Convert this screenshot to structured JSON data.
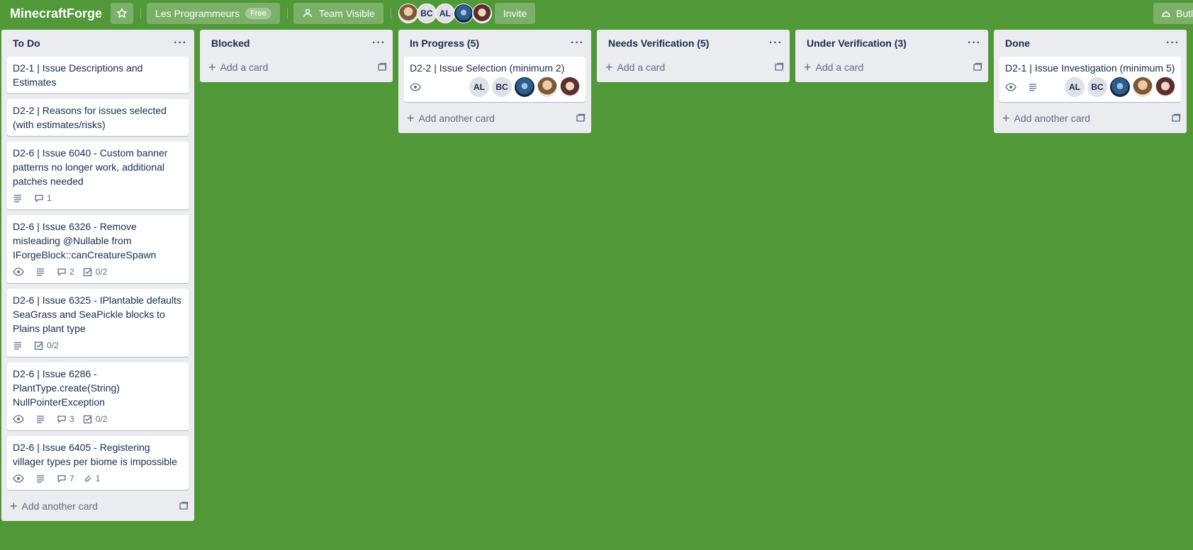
{
  "header": {
    "board_title": "MinecraftForge",
    "team_name": "Les Programmeurs",
    "plan_badge": "Free",
    "visibility": "Team Visible",
    "member_initials": [
      "BC",
      "AL"
    ],
    "invite": "Invite",
    "right_button": "Butler"
  },
  "lists": [
    {
      "title": "To Do",
      "cards": [
        {
          "title": "D2-1 | Issue Descriptions and Estimates"
        },
        {
          "title": "D2-2 | Reasons for issues selected (with estimates/risks)"
        },
        {
          "title": "D2-6 | Issue 6040 - Custom banner patterns no longer work, additional patches needed",
          "comments": "1"
        },
        {
          "title": "D2-6 | Issue 6326 - Remove misleading @Nullable from IForgeBlock::canCreatureSpawn",
          "comments": "2",
          "checklist": "0/2"
        },
        {
          "title": "D2-6 | Issue 6325 - IPlantable defaults SeaGrass and SeaPickle blocks to Plains plant type",
          "checklist": "0/2"
        },
        {
          "title": "D2-6 | Issue 6286 - PlantType.create(String) NullPointerException",
          "comments": "3",
          "checklist": "0/2"
        },
        {
          "title": "D2-6 | Issue 6405 - Registering villager types per biome is impossible",
          "comments": "7",
          "attachments": "1"
        }
      ],
      "add_label": "Add another card"
    },
    {
      "title": "Blocked",
      "add_label": "Add a card"
    },
    {
      "title": "In Progress (5)",
      "cards": [
        {
          "title": "D2-2 | Issue Selection (minimum 2)",
          "members": [
            "AL",
            "BC"
          ]
        }
      ],
      "add_label": "Add another card"
    },
    {
      "title": "Needs Verification (5)",
      "add_label": "Add a card"
    },
    {
      "title": "Under Verification (3)",
      "add_label": "Add a card"
    },
    {
      "title": "Done",
      "cards": [
        {
          "title": "D2-1 | Issue Investigation (minimum 5)",
          "members": [
            "AL",
            "BC"
          ]
        }
      ],
      "add_label": "Add another card"
    }
  ],
  "colors": {
    "board_bg": "#519839",
    "list_bg": "#ebecf0",
    "card_bg": "#ffffff"
  }
}
